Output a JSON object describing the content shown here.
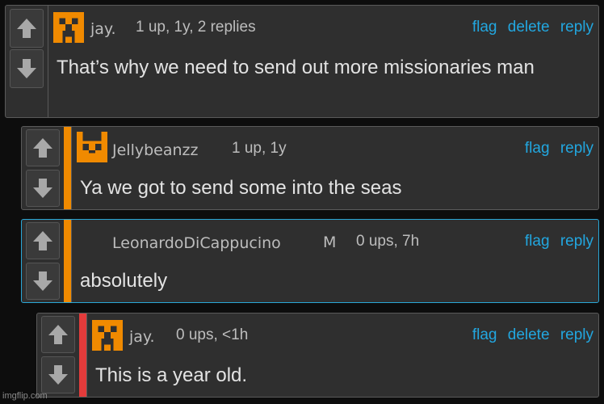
{
  "comments": [
    {
      "username": "jay.",
      "meta": "1 up, 1y, 2 replies",
      "actions": [
        "flag",
        "delete",
        "reply"
      ],
      "text": "That’s why we need to send out more missionaries man",
      "avatar": "orange-creeper-icon"
    },
    {
      "username": "Jellybeanzz",
      "meta": "1 up, 1y",
      "actions": [
        "flag",
        "reply"
      ],
      "text": "Ya we got to send some into the seas",
      "avatar": "orange-cat-icon",
      "bar_color": "#f08a00"
    },
    {
      "username": "LeonardoDiCappucino",
      "mod_badge": "M",
      "meta": "0 ups, 7h",
      "actions": [
        "flag",
        "reply"
      ],
      "text": "absolutely",
      "bar_color": "#f08a00",
      "border_color": "#2aa7d6"
    },
    {
      "username": "jay.",
      "meta": "0 ups, <1h",
      "actions": [
        "flag",
        "delete",
        "reply"
      ],
      "text": "This is a year old.",
      "avatar": "orange-creeper-icon",
      "bar_color": "#e33b3b"
    }
  ],
  "watermark": "imgflip.com",
  "colors": {
    "link": "#22a7e0",
    "panel": "#2f2f2f",
    "background": "#0d0d0d",
    "orange": "#f08a00",
    "red": "#e33b3b"
  }
}
